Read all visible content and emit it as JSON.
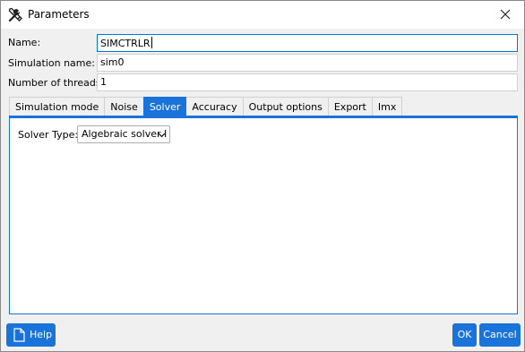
{
  "window": {
    "title": "Parameters",
    "icon": "tools-icon",
    "close_icon": "close-icon"
  },
  "fields": {
    "name_label": "Name:",
    "name_value": "SIMCTRLR",
    "simulation_name_label": "Simulation name:",
    "simulation_name_value": "sim0",
    "threads_label": "Number of threads:",
    "threads_value": "1"
  },
  "tabs": [
    {
      "label": "Simulation mode",
      "active": false
    },
    {
      "label": "Noise",
      "active": false
    },
    {
      "label": "Solver",
      "active": true
    },
    {
      "label": "Accuracy",
      "active": false
    },
    {
      "label": "Output options",
      "active": false
    },
    {
      "label": "Export",
      "active": false
    },
    {
      "label": "Imx",
      "active": false
    }
  ],
  "solver": {
    "type_label": "Solver Type:",
    "type_value": "Algebraic solver I"
  },
  "footer": {
    "help_label": "Help",
    "ok_label": "OK",
    "cancel_label": "Cancel"
  },
  "colors": {
    "accent": "#1a73d8",
    "background": "#f0f0f0"
  }
}
